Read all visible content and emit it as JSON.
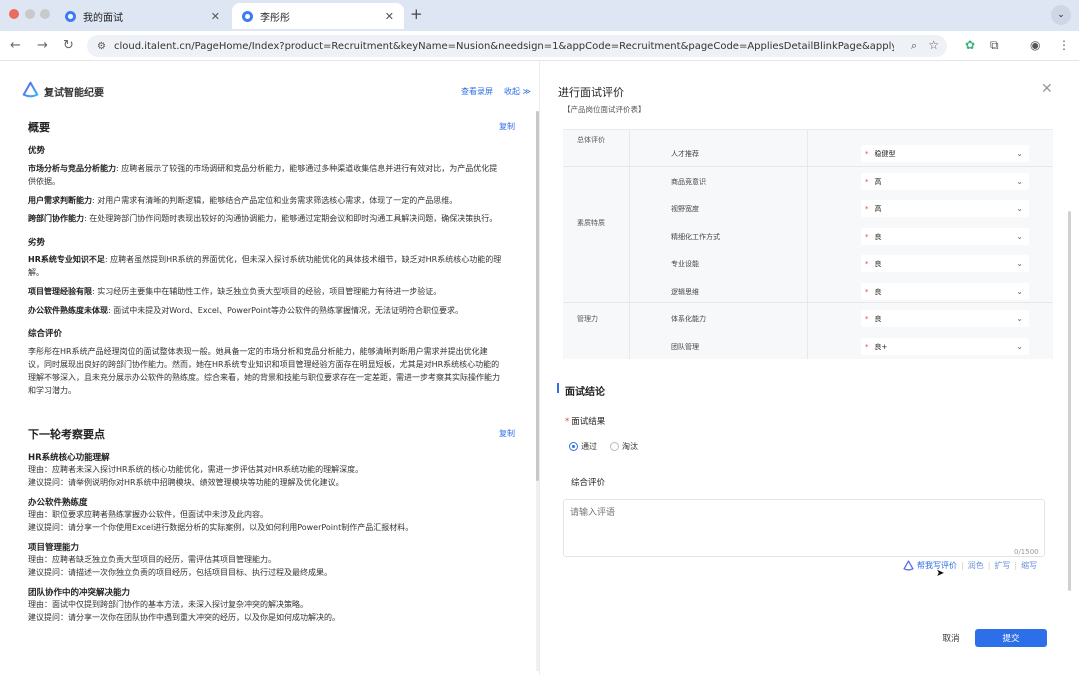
{
  "browser": {
    "tabs": [
      {
        "label": "我的面试",
        "active": false
      },
      {
        "label": "李彤彤",
        "active": true
      }
    ],
    "url": "cloud.italent.cn/PageHome/Index?product=Recruitment&keyName=Nusion&needsign=1&appCode=Recruitment&pageCode=AppliesDetailBlinkPage&applyId=5..."
  },
  "left": {
    "title": "复试智能纪要",
    "view_recording": "查看录屏",
    "collapse": "收起 ≫",
    "copy_label": "复制",
    "summary_title": "概要",
    "strengths_title": "优势",
    "strengths": [
      {
        "head": "市场分析与竞品分析能力",
        "text": ": 应聘者展示了较强的市场调研和竞品分析能力，能够通过多种渠道收集信息并进行有效对比，为产品优化提"
      },
      {
        "head": "",
        "text": "供依据。"
      },
      {
        "head": "用户需求判断能力",
        "text": ": 对用户需求有清晰的判断逻辑，能够结合产品定位和业务需求筛选核心需求，体现了一定的产品思维。"
      },
      {
        "head": "跨部门协作能力",
        "text": ": 在处理跨部门协作问题时表现出较好的沟通协调能力，能够通过定期会议和即时沟通工具解决问题，确保决策执行。"
      }
    ],
    "weakness_title": "劣势",
    "weaknesses": [
      {
        "head": "HR系统专业知识不足",
        "text": ": 应聘者虽然提到HR系统的界面优化，但未深入探讨系统功能优化的具体技术细节，缺乏对HR系统核心功能的理"
      },
      {
        "head": "",
        "text": "解。"
      },
      {
        "head": "项目管理经验有限",
        "text": ": 实习经历主要集中在辅助性工作，缺乏独立负责大型项目的经验，项目管理能力有待进一步验证。"
      },
      {
        "head": "办公软件熟练度未体现",
        "text": ": 面试中未提及对Word、Excel、PowerPoint等办公软件的熟练掌握情况，无法证明符合职位要求。"
      }
    ],
    "overall_title": "综合评价",
    "overall_lines": [
      "李彤彤在HR系统产品经理岗位的面试整体表现一般。她具备一定的市场分析和竞品分析能力，能够清晰判断用户需求并提出优化建",
      "议，同时展现出良好的跨部门协作能力。然而，她在HR系统专业知识和项目管理经验方面存在明显短板，尤其是对HR系统核心功能的",
      "理解不够深入，且未充分展示办公软件的熟练度。综合来看，她的背景和技能与职位要求存在一定差距，需进一步考察其实际操作能力",
      "和学习潜力。"
    ],
    "next_title": "下一轮考察要点",
    "next_items": [
      {
        "head": "HR系统核心功能理解",
        "reason": "理由：应聘者未深入探讨HR系统的核心功能优化，需进一步评估其对HR系统功能的理解深度。",
        "ask": "建议提问：请举例说明你对HR系统中招聘模块、绩效管理模块等功能的理解及优化建议。"
      },
      {
        "head": "办公软件熟练度",
        "reason": "理由：职位要求应聘者熟练掌握办公软件，但面试中未涉及此内容。",
        "ask": "建议提问：请分享一个你使用Excel进行数据分析的实际案例，以及如何利用PowerPoint制作产品汇报材料。"
      },
      {
        "head": "项目管理能力",
        "reason": "理由：应聘者缺乏独立负责大型项目的经历，需评估其项目管理能力。",
        "ask": "建议提问：请描述一次你独立负责的项目经历，包括项目目标、执行过程及最终成果。"
      },
      {
        "head": "团队协作中的冲突解决能力",
        "reason": "理由：面试中仅提到跨部门协作的基本方法，未深入探讨复杂冲突的解决策略。",
        "ask": "建议提问：请分享一次你在团队协作中遇到重大冲突的经历，以及你是如何成功解决的。"
      }
    ]
  },
  "right": {
    "title": "进行面试评价",
    "subtitle": "【产品岗位面试评价表】",
    "groups": [
      "总体评价",
      "素质特质",
      "管理力"
    ],
    "items": [
      {
        "label": "人才推荐",
        "value": "稳健型"
      },
      {
        "label": "商品竞意识",
        "value": "高"
      },
      {
        "label": "视野宽度",
        "value": "高"
      },
      {
        "label": "精细化工作方式",
        "value": "良"
      },
      {
        "label": "专业设能",
        "value": "良"
      },
      {
        "label": "逻辑思维",
        "value": "良"
      },
      {
        "label": "体系化能力",
        "value": "良"
      },
      {
        "label": "团队管理",
        "value": "良+"
      }
    ],
    "conclusion_title": "面试结论",
    "result_label": "面试结果",
    "options": [
      "通过",
      "淘汰"
    ],
    "selected_option": "通过",
    "comment_label": "综合评价",
    "comment_placeholder": "请输入评语",
    "counter": "0/1500",
    "ai_tools": [
      "帮我写评价",
      "润色",
      "扩写",
      "缩写"
    ],
    "cancel": "取消",
    "submit": "提交"
  }
}
